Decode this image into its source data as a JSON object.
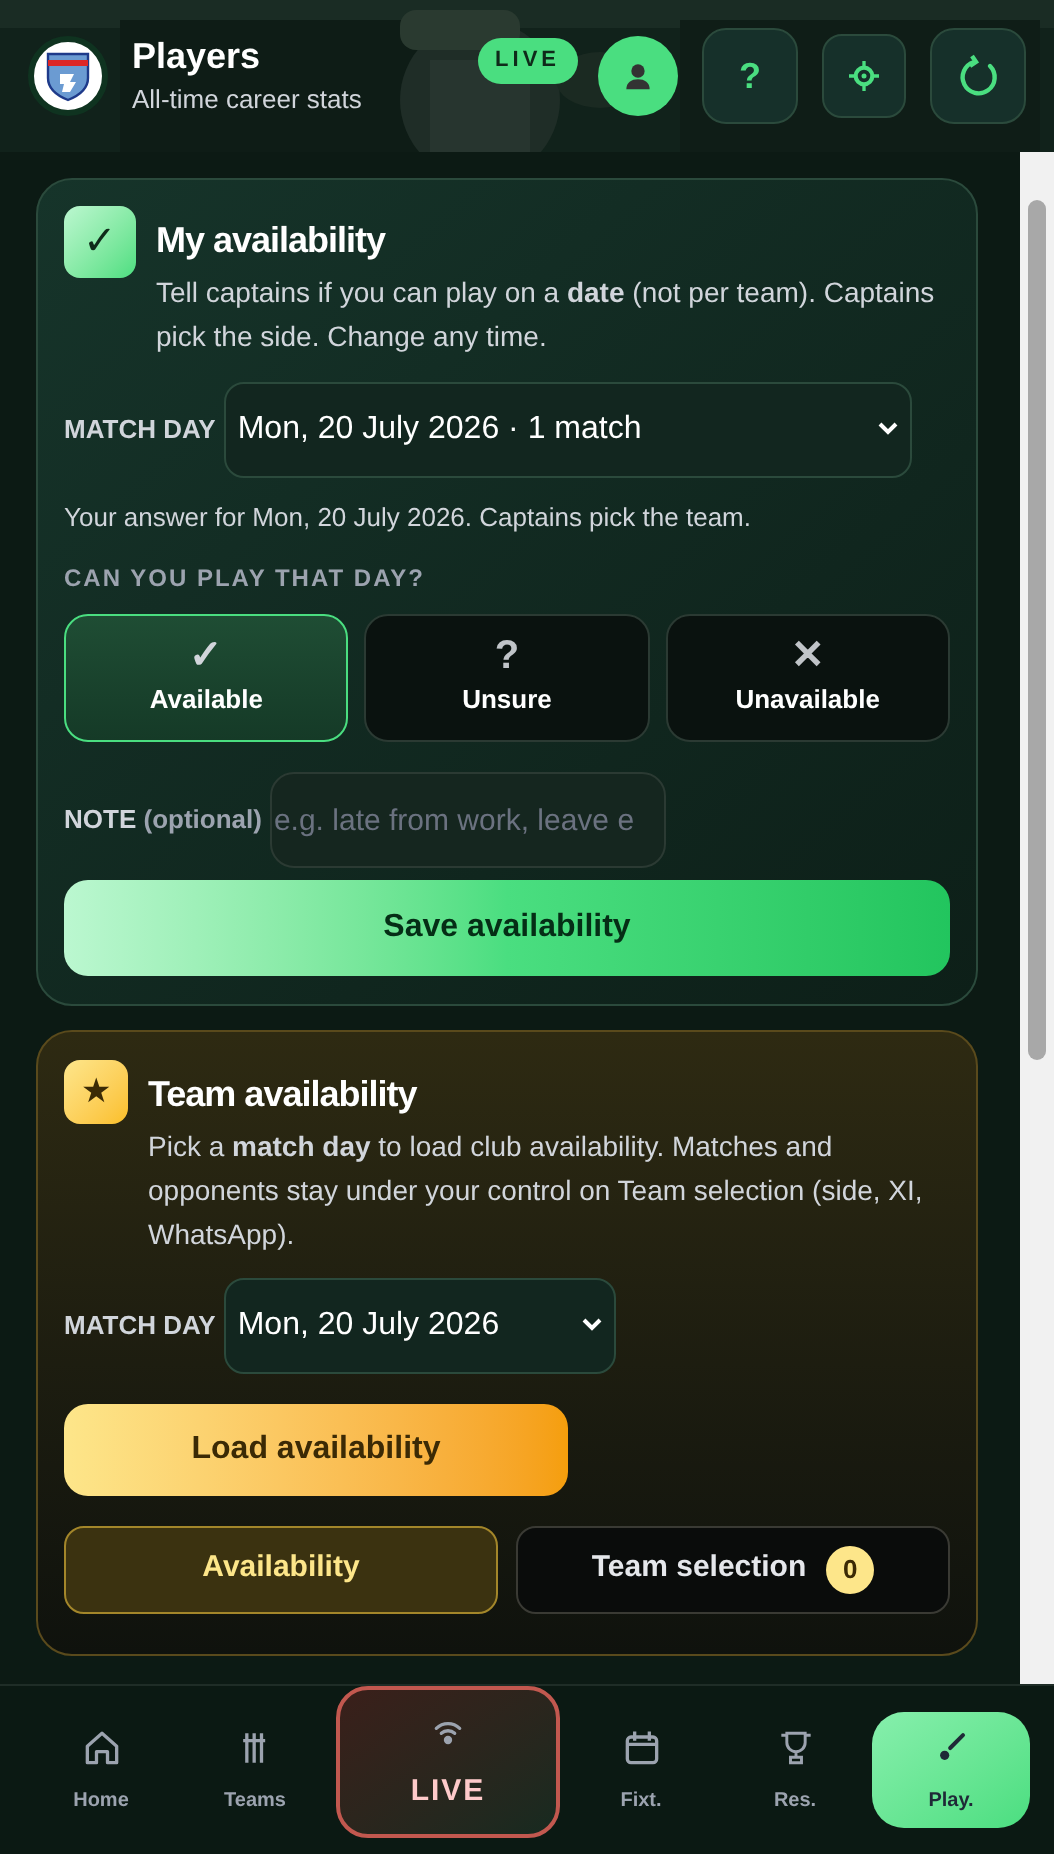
{
  "header": {
    "title": "Players",
    "subtitle": "All-time career stats",
    "live_badge": "LIVE",
    "buttons": [
      {
        "kind": "profile"
      },
      {
        "kind": "help",
        "label": "?"
      },
      {
        "kind": "settings"
      },
      {
        "kind": "refresh"
      }
    ]
  },
  "my_availability": {
    "symbol": "✓",
    "title": "My availability",
    "description": "Tell captains if you can play on a **date** (not per team). Captains pick the side. Change any time.",
    "match_day": {
      "label": "MATCH DAY",
      "value": "Mon, 20 July 2026 · 1 match"
    },
    "answer_note": "Your answer for Mon, 20 July 2026. Captains pick the team.",
    "question": "CAN YOU PLAY THAT DAY?",
    "options": [
      {
        "symbol": "✓",
        "label": "Available",
        "selected": true
      },
      {
        "symbol": "?",
        "label": "Unsure",
        "selected": false
      },
      {
        "symbol": "✕",
        "label": "Unavailable",
        "selected": false
      }
    ],
    "note": {
      "label": "NOTE",
      "hint": "(optional)",
      "placeholder": "e.g. late from work, leave e"
    },
    "save_button": "Save availability"
  },
  "team_availability": {
    "symbol": "★",
    "title": "Team availability",
    "description": "Pick a **match day** to load club availability. Matches and opponents stay under your control on Team selection (side, XI, WhatsApp).",
    "match_day": {
      "label": "MATCH DAY",
      "value": "Mon, 20 July 2026"
    },
    "load_button": "Load availability",
    "tabs": [
      {
        "label": "Availability",
        "selected": true
      },
      {
        "label": "Team selection",
        "count": "0",
        "selected": false
      }
    ]
  },
  "bottom_nav": [
    {
      "kind": "home",
      "label": "Home",
      "selected": false
    },
    {
      "kind": "teams",
      "label": "Teams",
      "selected": false
    },
    {
      "kind": "live",
      "label": "LIVE",
      "selected": false
    },
    {
      "kind": "fixtures",
      "label": "Fixt.",
      "selected": false
    },
    {
      "kind": "results",
      "label": "Res.",
      "selected": false
    },
    {
      "kind": "players",
      "label": "Play.",
      "selected": true
    }
  ]
}
